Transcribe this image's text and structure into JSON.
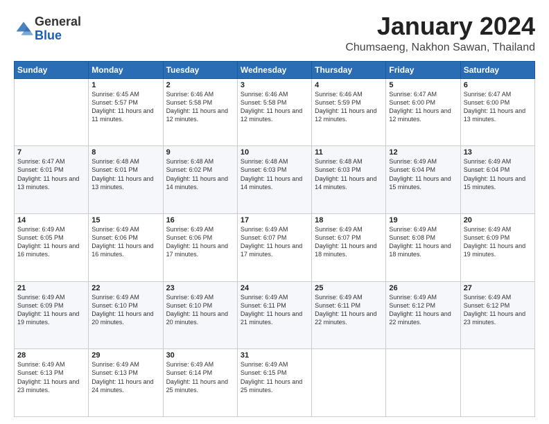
{
  "logo": {
    "general": "General",
    "blue": "Blue"
  },
  "title": "January 2024",
  "location": "Chumsaeng, Nakhon Sawan, Thailand",
  "days_of_week": [
    "Sunday",
    "Monday",
    "Tuesday",
    "Wednesday",
    "Thursday",
    "Friday",
    "Saturday"
  ],
  "weeks": [
    [
      {
        "day": "",
        "sunrise": "",
        "sunset": "",
        "daylight": ""
      },
      {
        "day": "1",
        "sunrise": "Sunrise: 6:45 AM",
        "sunset": "Sunset: 5:57 PM",
        "daylight": "Daylight: 11 hours and 11 minutes."
      },
      {
        "day": "2",
        "sunrise": "Sunrise: 6:46 AM",
        "sunset": "Sunset: 5:58 PM",
        "daylight": "Daylight: 11 hours and 12 minutes."
      },
      {
        "day": "3",
        "sunrise": "Sunrise: 6:46 AM",
        "sunset": "Sunset: 5:58 PM",
        "daylight": "Daylight: 11 hours and 12 minutes."
      },
      {
        "day": "4",
        "sunrise": "Sunrise: 6:46 AM",
        "sunset": "Sunset: 5:59 PM",
        "daylight": "Daylight: 11 hours and 12 minutes."
      },
      {
        "day": "5",
        "sunrise": "Sunrise: 6:47 AM",
        "sunset": "Sunset: 6:00 PM",
        "daylight": "Daylight: 11 hours and 12 minutes."
      },
      {
        "day": "6",
        "sunrise": "Sunrise: 6:47 AM",
        "sunset": "Sunset: 6:00 PM",
        "daylight": "Daylight: 11 hours and 13 minutes."
      }
    ],
    [
      {
        "day": "7",
        "sunrise": "Sunrise: 6:47 AM",
        "sunset": "Sunset: 6:01 PM",
        "daylight": "Daylight: 11 hours and 13 minutes."
      },
      {
        "day": "8",
        "sunrise": "Sunrise: 6:48 AM",
        "sunset": "Sunset: 6:01 PM",
        "daylight": "Daylight: 11 hours and 13 minutes."
      },
      {
        "day": "9",
        "sunrise": "Sunrise: 6:48 AM",
        "sunset": "Sunset: 6:02 PM",
        "daylight": "Daylight: 11 hours and 14 minutes."
      },
      {
        "day": "10",
        "sunrise": "Sunrise: 6:48 AM",
        "sunset": "Sunset: 6:03 PM",
        "daylight": "Daylight: 11 hours and 14 minutes."
      },
      {
        "day": "11",
        "sunrise": "Sunrise: 6:48 AM",
        "sunset": "Sunset: 6:03 PM",
        "daylight": "Daylight: 11 hours and 14 minutes."
      },
      {
        "day": "12",
        "sunrise": "Sunrise: 6:49 AM",
        "sunset": "Sunset: 6:04 PM",
        "daylight": "Daylight: 11 hours and 15 minutes."
      },
      {
        "day": "13",
        "sunrise": "Sunrise: 6:49 AM",
        "sunset": "Sunset: 6:04 PM",
        "daylight": "Daylight: 11 hours and 15 minutes."
      }
    ],
    [
      {
        "day": "14",
        "sunrise": "Sunrise: 6:49 AM",
        "sunset": "Sunset: 6:05 PM",
        "daylight": "Daylight: 11 hours and 16 minutes."
      },
      {
        "day": "15",
        "sunrise": "Sunrise: 6:49 AM",
        "sunset": "Sunset: 6:06 PM",
        "daylight": "Daylight: 11 hours and 16 minutes."
      },
      {
        "day": "16",
        "sunrise": "Sunrise: 6:49 AM",
        "sunset": "Sunset: 6:06 PM",
        "daylight": "Daylight: 11 hours and 17 minutes."
      },
      {
        "day": "17",
        "sunrise": "Sunrise: 6:49 AM",
        "sunset": "Sunset: 6:07 PM",
        "daylight": "Daylight: 11 hours and 17 minutes."
      },
      {
        "day": "18",
        "sunrise": "Sunrise: 6:49 AM",
        "sunset": "Sunset: 6:07 PM",
        "daylight": "Daylight: 11 hours and 18 minutes."
      },
      {
        "day": "19",
        "sunrise": "Sunrise: 6:49 AM",
        "sunset": "Sunset: 6:08 PM",
        "daylight": "Daylight: 11 hours and 18 minutes."
      },
      {
        "day": "20",
        "sunrise": "Sunrise: 6:49 AM",
        "sunset": "Sunset: 6:09 PM",
        "daylight": "Daylight: 11 hours and 19 minutes."
      }
    ],
    [
      {
        "day": "21",
        "sunrise": "Sunrise: 6:49 AM",
        "sunset": "Sunset: 6:09 PM",
        "daylight": "Daylight: 11 hours and 19 minutes."
      },
      {
        "day": "22",
        "sunrise": "Sunrise: 6:49 AM",
        "sunset": "Sunset: 6:10 PM",
        "daylight": "Daylight: 11 hours and 20 minutes."
      },
      {
        "day": "23",
        "sunrise": "Sunrise: 6:49 AM",
        "sunset": "Sunset: 6:10 PM",
        "daylight": "Daylight: 11 hours and 20 minutes."
      },
      {
        "day": "24",
        "sunrise": "Sunrise: 6:49 AM",
        "sunset": "Sunset: 6:11 PM",
        "daylight": "Daylight: 11 hours and 21 minutes."
      },
      {
        "day": "25",
        "sunrise": "Sunrise: 6:49 AM",
        "sunset": "Sunset: 6:11 PM",
        "daylight": "Daylight: 11 hours and 22 minutes."
      },
      {
        "day": "26",
        "sunrise": "Sunrise: 6:49 AM",
        "sunset": "Sunset: 6:12 PM",
        "daylight": "Daylight: 11 hours and 22 minutes."
      },
      {
        "day": "27",
        "sunrise": "Sunrise: 6:49 AM",
        "sunset": "Sunset: 6:12 PM",
        "daylight": "Daylight: 11 hours and 23 minutes."
      }
    ],
    [
      {
        "day": "28",
        "sunrise": "Sunrise: 6:49 AM",
        "sunset": "Sunset: 6:13 PM",
        "daylight": "Daylight: 11 hours and 23 minutes."
      },
      {
        "day": "29",
        "sunrise": "Sunrise: 6:49 AM",
        "sunset": "Sunset: 6:13 PM",
        "daylight": "Daylight: 11 hours and 24 minutes."
      },
      {
        "day": "30",
        "sunrise": "Sunrise: 6:49 AM",
        "sunset": "Sunset: 6:14 PM",
        "daylight": "Daylight: 11 hours and 25 minutes."
      },
      {
        "day": "31",
        "sunrise": "Sunrise: 6:49 AM",
        "sunset": "Sunset: 6:15 PM",
        "daylight": "Daylight: 11 hours and 25 minutes."
      },
      {
        "day": "",
        "sunrise": "",
        "sunset": "",
        "daylight": ""
      },
      {
        "day": "",
        "sunrise": "",
        "sunset": "",
        "daylight": ""
      },
      {
        "day": "",
        "sunrise": "",
        "sunset": "",
        "daylight": ""
      }
    ]
  ]
}
